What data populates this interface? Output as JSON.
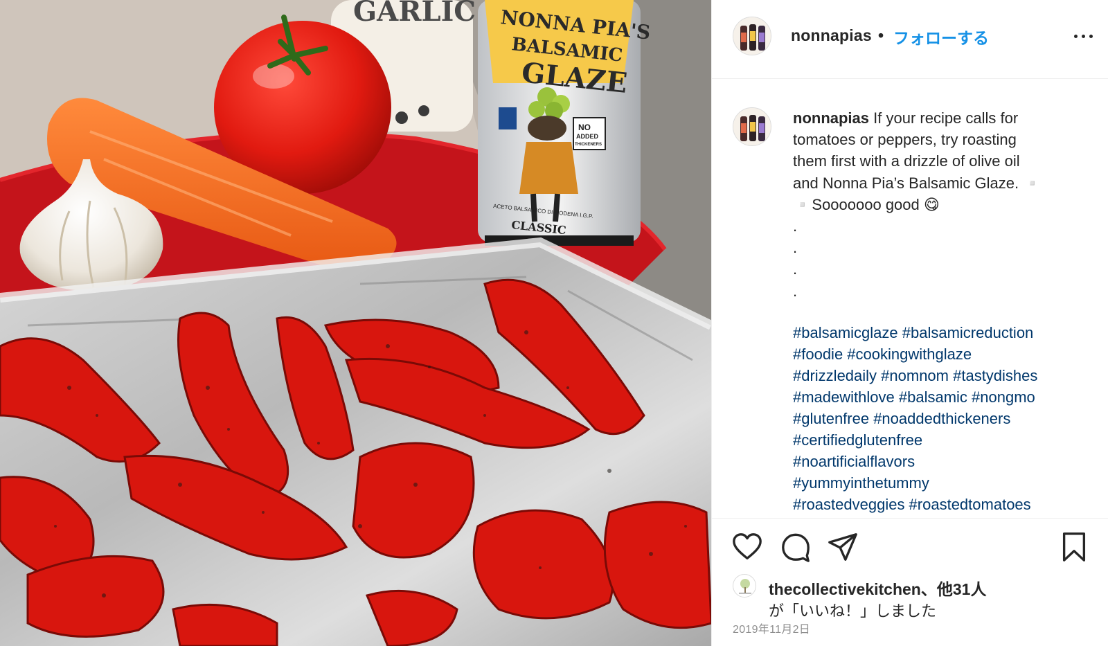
{
  "photo": {
    "alt_icon": "food-photo",
    "garlic_jar_text": "GARLIC",
    "bottle_label": [
      "NONNA PIA'S",
      "BALSAMIC",
      "GLAZE"
    ],
    "bottle_badge": [
      "NO",
      "ADDED",
      "THICKENERS"
    ],
    "bottle_small": "ACETO BALSAMICO DI MODENA I.G.P.",
    "bottle_classic": "CLASSIC"
  },
  "header": {
    "username": "nonnapias",
    "separator": "•",
    "follow_label": "フォローする"
  },
  "post": {
    "username": "nonnapias",
    "caption_lines": [
      "If your recipe calls for",
      "tomatoes or peppers, try roasting",
      "them first with a drizzle of olive oil",
      "and Nonna Pia’s Balsamic Glaze. ▫️",
      "▫️Sooooooo good 😋",
      ".",
      ".",
      ".",
      "."
    ],
    "hashtag_lines": [
      "#balsamicglaze #balsamicreduction",
      "#foodie #cookingwithglaze",
      "#drizzledaily #nomnom #tastydishes",
      "#madewithlove #balsamic #nongmo",
      "#glutenfree #noaddedthickeners",
      "#certifiedglutenfree",
      "#noartificialflavors",
      "#yummyinthetummy",
      "#roastedveggies #roastedtomatoes"
    ]
  },
  "actions": {
    "icons": [
      "heart-icon",
      "comment-icon",
      "share-icon",
      "bookmark-icon"
    ]
  },
  "likes": {
    "liker": "thecollectivekitchen、他31人",
    "suffix": "が「いいね！」しました"
  },
  "date": "2019年11月2日",
  "colors": {
    "link": "#00376b",
    "follow": "#1591e6",
    "text": "#262626",
    "muted": "#8e8e8e",
    "border": "#efefef"
  }
}
